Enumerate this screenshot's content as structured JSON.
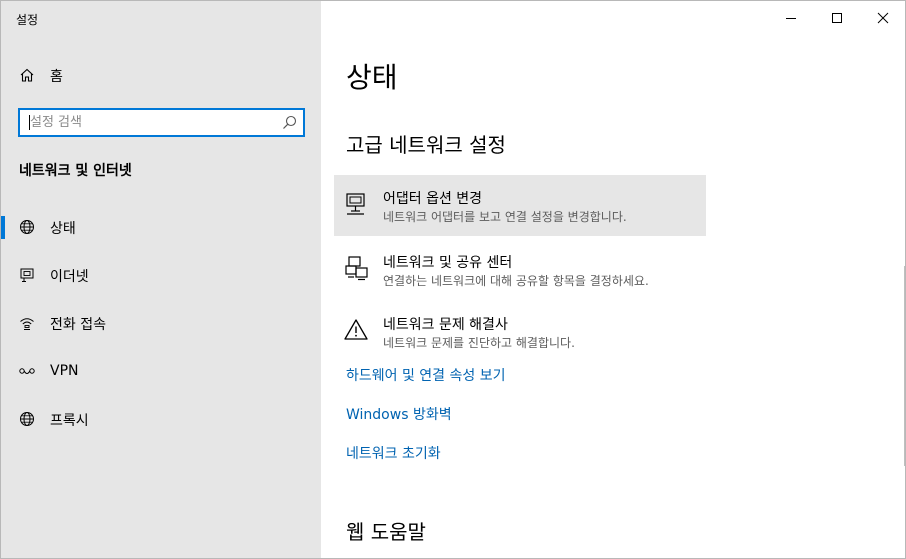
{
  "window": {
    "title": "설정"
  },
  "sidebar": {
    "home_label": "홈",
    "search_placeholder": "설정 검색",
    "section_title": "네트워크 및 인터넷",
    "items": [
      {
        "label": "상태",
        "icon": "globe-icon",
        "active": true
      },
      {
        "label": "이더넷",
        "icon": "ethernet-icon",
        "active": false
      },
      {
        "label": "전화 접속",
        "icon": "dialup-icon",
        "active": false
      },
      {
        "label": "VPN",
        "icon": "vpn-icon",
        "active": false
      },
      {
        "label": "프록시",
        "icon": "globe-icon",
        "active": false
      }
    ]
  },
  "main": {
    "title": "상태",
    "subtitle": "고급 네트워크 설정",
    "options": [
      {
        "title": "어댑터 옵션 변경",
        "desc": "네트워크 어댑터를 보고 연결 설정을 변경합니다.",
        "icon": "adapter-icon"
      },
      {
        "title": "네트워크 및 공유 센터",
        "desc": "연결하는 네트워크에 대해 공유할 항목을 결정하세요.",
        "icon": "sharing-center-icon"
      },
      {
        "title": "네트워크 문제 해결사",
        "desc": "네트워크 문제를 진단하고 해결합니다.",
        "icon": "warning-icon"
      }
    ],
    "links": [
      "하드웨어 및 연결 속성 보기",
      "Windows 방화벽",
      "네트워크 초기화"
    ],
    "help_title": "웹 도움말"
  },
  "colors": {
    "accent": "#0078d7",
    "link": "#0063b1",
    "sidebar_bg": "#e6e6e6"
  }
}
